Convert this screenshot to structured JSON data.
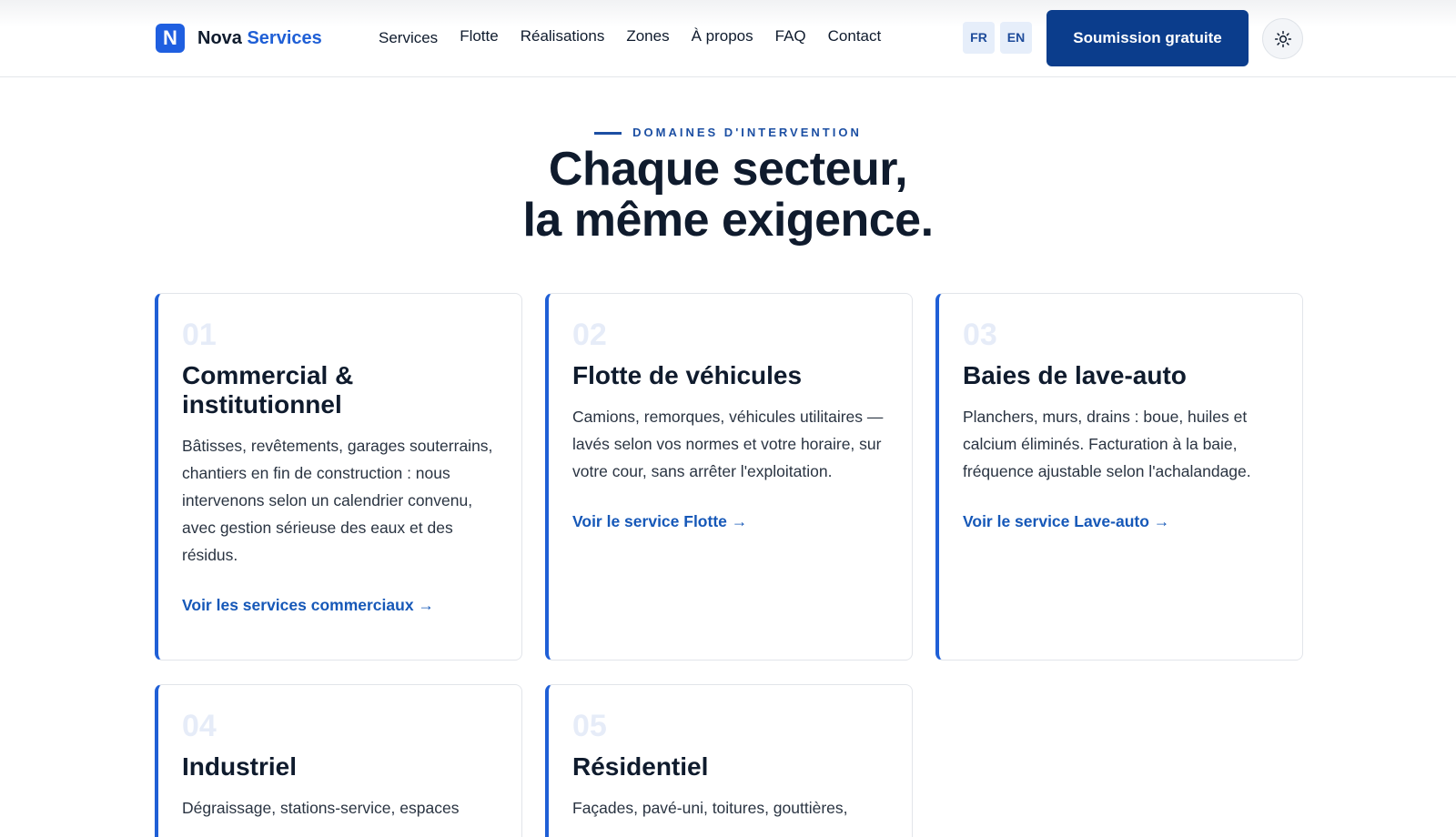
{
  "header": {
    "logo_letter": "N",
    "brand_name": "Nova",
    "brand_accent": "Services",
    "nav": [
      "Services",
      "Flotte",
      "Réalisations",
      "Zones",
      "À propos",
      "FAQ",
      "Contact"
    ],
    "lang": [
      "FR",
      "EN"
    ],
    "cta_label": "Soumission gratuite",
    "theme_icon": "sun-icon"
  },
  "hero": {
    "eyebrow": "DOMAINES D'INTERVENTION",
    "title_line1": "Chaque secteur,",
    "title_line2": "la même exigence."
  },
  "cards": [
    {
      "num": "01",
      "title": "Commercial & institutionnel",
      "text": "Bâtisses, revêtements, garages souterrains, chantiers en fin de construction : nous intervenons selon un calendrier convenu, avec gestion sérieuse des eaux et des résidus.",
      "link": "Voir les services commerciaux →"
    },
    {
      "num": "02",
      "title": "Flotte de véhicules",
      "text": "Camions, remorques, véhicules utilitaires — lavés selon vos normes et votre horaire, sur votre cour, sans arrêter l'exploitation.",
      "link": "Voir le service Flotte →"
    },
    {
      "num": "03",
      "title": "Baies de lave-auto",
      "text": "Planchers, murs, drains : boue, huiles et calcium éliminés. Facturation à la baie, fréquence ajustable selon l'achalandage.",
      "link": "Voir le service Lave-auto →"
    },
    {
      "num": "04",
      "title": "Industriel",
      "text": "Dégraissage, stations-service, espaces"
    },
    {
      "num": "05",
      "title": "Résidentiel",
      "text": "Façades, pavé-uni, toitures, gouttières,"
    }
  ],
  "colors": {
    "brand_blue": "#1f5fd6",
    "cta_navy": "#0b3d8c",
    "text_dark": "#0f1b2d"
  }
}
